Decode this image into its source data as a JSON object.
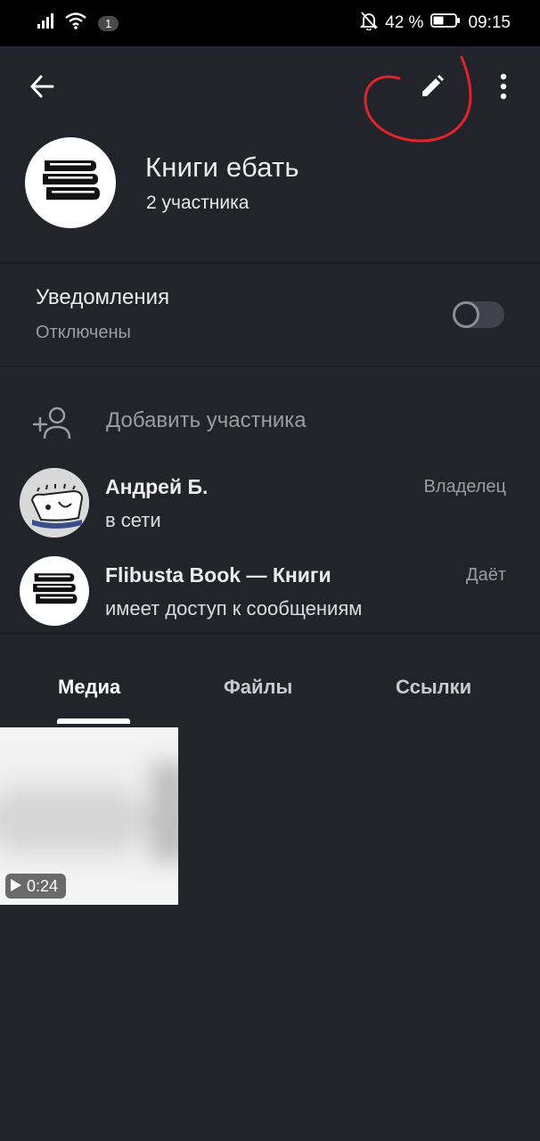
{
  "status_bar": {
    "notification_count": "1",
    "battery_percent": "42 %",
    "time": "09:15"
  },
  "header": {
    "back_icon": "arrow-left-icon",
    "edit_icon": "pencil-icon",
    "more_icon": "more-vertical-icon"
  },
  "group": {
    "name": "Книги ебать",
    "members": "2 участника"
  },
  "notifications": {
    "title": "Уведомления",
    "status": "Отключены",
    "enabled": false
  },
  "add_member": {
    "label": "Добавить участника"
  },
  "members": [
    {
      "name": "Андрей Б.",
      "status": "в сети",
      "role": "Владелец"
    },
    {
      "name": "Flibusta Book — Книги",
      "status": "имеет доступ к сообщениям",
      "role": "Даёт"
    }
  ],
  "tabs": [
    {
      "label": "Медиа",
      "active": true
    },
    {
      "label": "Файлы",
      "active": false
    },
    {
      "label": "Ссылки",
      "active": false
    }
  ],
  "media": [
    {
      "duration": "0:24"
    }
  ],
  "colors": {
    "background": "#22232b",
    "annotation": "#e0242c"
  }
}
